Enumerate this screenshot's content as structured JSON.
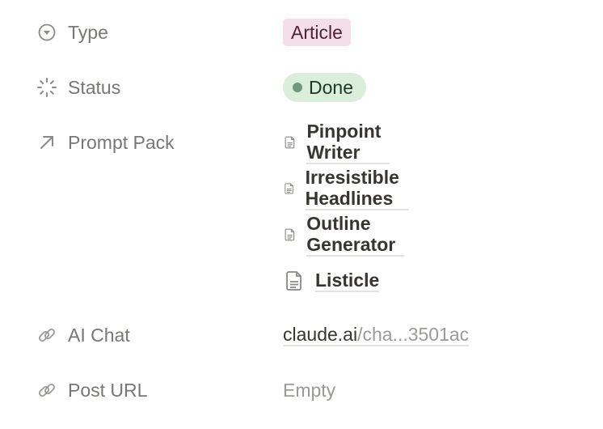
{
  "properties": {
    "type": {
      "label": "Type",
      "icon": "dropdown-circle-icon",
      "value": "Article",
      "tag_bg": "#f4dfe8",
      "tag_color": "#4c2337"
    },
    "status": {
      "label": "Status",
      "icon": "status-spinner-icon",
      "value": "Done",
      "dot_color": "#6c9b7d",
      "pill_bg": "#dbeddb"
    },
    "prompt_pack": {
      "label": "Prompt Pack",
      "icon": "relation-arrow-icon",
      "items": [
        "Pinpoint Writer",
        "Irresistible Headlines",
        "Outline Generator",
        "Listicle"
      ]
    },
    "ai_chat": {
      "label": "AI Chat",
      "icon": "link-icon",
      "domain": "claude.ai",
      "rest": "/cha...3501ac"
    },
    "post_url": {
      "label": "Post URL",
      "icon": "link-icon",
      "value": "Empty"
    }
  }
}
